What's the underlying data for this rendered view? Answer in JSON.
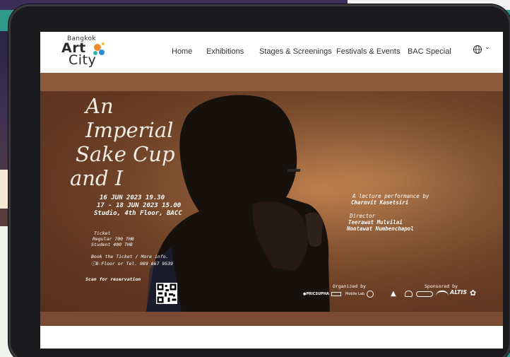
{
  "logo": {
    "top": "Bangkok",
    "art": "Art",
    "city": "City"
  },
  "nav": {
    "items": [
      "Home",
      "Exhibitions",
      "Stages & Screenings",
      "Festivals & Events",
      "BAC Special"
    ],
    "language_icon": "globe-icon",
    "dropdown_icon": "chevron-down-icon"
  },
  "poster": {
    "title": [
      "An",
      "Imperial",
      "Sake Cup",
      "and I"
    ],
    "date1": "16 JUN 2023 19.30",
    "date2": "17 - 18 JUN 2023 15.00",
    "venue": "Studio, 4th Floor, BACC",
    "ticket_label": "Ticket",
    "ticket_regular": "Regular 700 THB",
    "ticket_student": "Student 400 THB",
    "booking_line1": "Book the Ticket / More info.",
    "booking_line2": "B-Floor or Tel. 089 667 9539",
    "scan_label": "Scan for reservation",
    "lecture_label": "A lecture performance by",
    "lecturer": "Charnvit Kasetsiri",
    "director_label": "Director",
    "director1": "Teerawat Mulvilai",
    "director2": "Nontawat Numbenchapol",
    "organized_label": "Organized by",
    "sponsored_label": "Sponsored by",
    "organizer_logos": [
      "PRICSUPHA",
      "Mobile Lab"
    ],
    "sponsor_logos": [
      "ALTIS"
    ]
  },
  "colors": {
    "nav_bg": "#ffffff",
    "banner_brown": "#a86a40",
    "dot_orange": "#f08a2c",
    "dot_blue": "#2a8bd6",
    "dot_teal": "#30b5a8"
  }
}
